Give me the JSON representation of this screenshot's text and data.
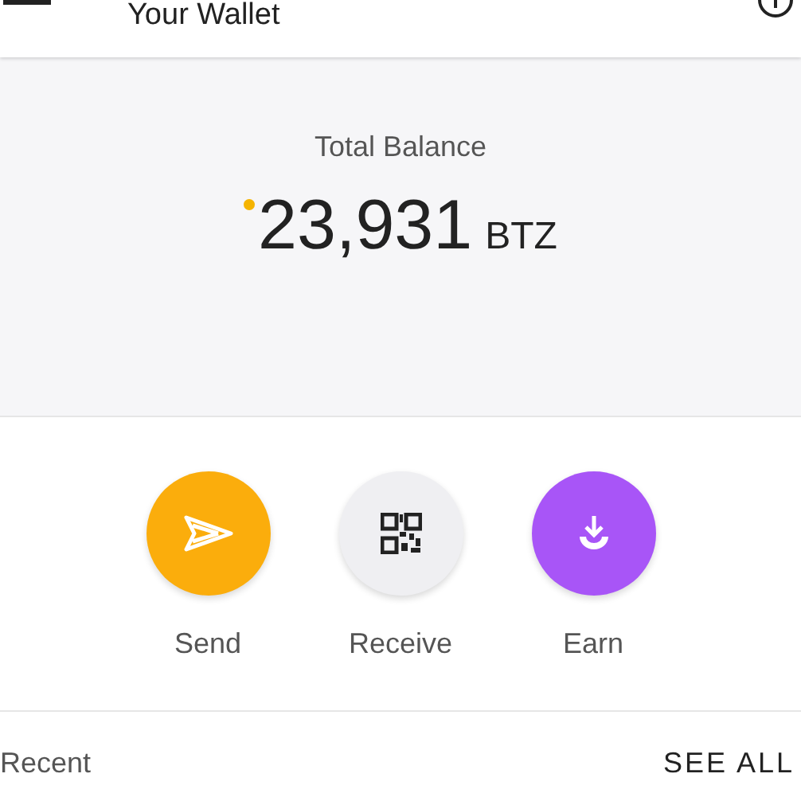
{
  "app_bar": {
    "title": "Your Wallet"
  },
  "balance": {
    "label": "Total Balance",
    "amount": "23,931",
    "unit": "BTZ"
  },
  "actions": [
    {
      "kind": "send",
      "label": "Send",
      "color": "#fbad0c"
    },
    {
      "kind": "receive",
      "label": "Receive",
      "color": "#efeff2"
    },
    {
      "kind": "earn",
      "label": "Earn",
      "color": "#a855f7"
    }
  ],
  "recent": {
    "title": "Recent",
    "link": "SEE ALL"
  }
}
